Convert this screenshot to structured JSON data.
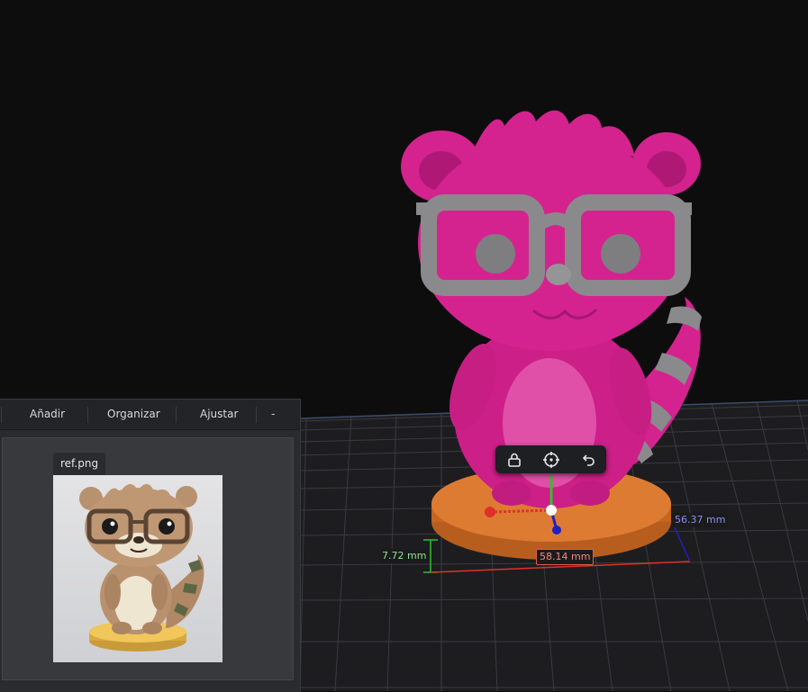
{
  "menu": {
    "items": [
      {
        "label": "Añadir"
      },
      {
        "label": "Organizar"
      },
      {
        "label": "Ajustar"
      },
      {
        "label": "-"
      }
    ]
  },
  "reference": {
    "label": "ref.png"
  },
  "toolbar": {
    "buttons": [
      {
        "icon": "lock-icon"
      },
      {
        "icon": "crosshair-icon"
      },
      {
        "icon": "undo-icon"
      }
    ]
  },
  "dimensions": {
    "height": "7.72 mm",
    "width": "58.14 mm",
    "depth": "56.37 mm"
  },
  "colors": {
    "model_body": "#d4238e",
    "model_glasses": "#8a8a8c",
    "model_base": "#d9772e",
    "axis_x": "#e0302a",
    "axis_y": "#2fc22f",
    "axis_z": "#2020c0"
  }
}
